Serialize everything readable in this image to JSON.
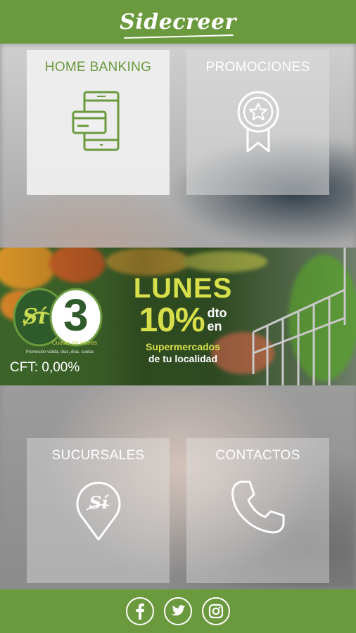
{
  "header": {
    "logo_text": "Sidecreer"
  },
  "tiles": {
    "home_banking": {
      "label": "HOME BANKING",
      "icon": "mobile-card-icon"
    },
    "promociones": {
      "label": "PROMOCIONES",
      "icon": "award-ribbon-icon"
    },
    "sucursales": {
      "label": "SUCURSALES",
      "icon": "location-pin-icon"
    },
    "contactos": {
      "label": "CONTACTOS",
      "icon": "phone-icon"
    }
  },
  "banner": {
    "badge_brand": "Sí",
    "badge_number": "3",
    "badge_caption": "Cuotas sin interés",
    "badge_fine_print": "Promoción válida, días, días, cuotas",
    "cft": "CFT: 0,00%",
    "day": "LUNES",
    "discount": "10%",
    "dto": "dto",
    "en": "en",
    "place_line1": "Supermercados",
    "place_line2": "de tu localidad"
  },
  "footer": {
    "social": [
      {
        "name": "facebook",
        "glyph": "f"
      },
      {
        "name": "twitter",
        "glyph": "twitter-bird"
      },
      {
        "name": "instagram",
        "glyph": "instagram-camera"
      }
    ]
  },
  "colors": {
    "brand_green": "#6b9a3e",
    "promo_yellow": "#d7e04a",
    "tile_white": "#f0f0f0"
  }
}
